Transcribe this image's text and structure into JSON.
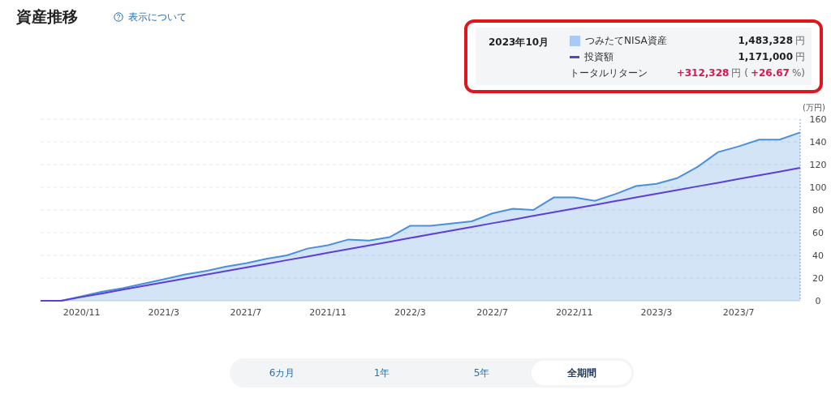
{
  "header": {
    "title": "資産推移",
    "help_link": "表示について"
  },
  "tooltip": {
    "month": "2023年10月",
    "rows": [
      {
        "kind": "swatch",
        "color": "#a9c9f7",
        "parts": [
          {
            "text": "1,483,328",
            "emphasis": false
          },
          {
            "text": "円",
            "emphasis": false
          }
        ]
      },
      {
        "kind": "line",
        "color": "#5b3fd8",
        "parts": [
          {
            "text": "1,171,000",
            "emphasis": false
          },
          {
            "text": "円",
            "emphasis": false
          }
        ]
      },
      {
        "kind": "plain",
        "label": "トータルリターン",
        "parts": [
          {
            "text": "+312,328",
            "emphasis": true
          },
          {
            "text": "円 (",
            "emphasis": false
          },
          {
            "text": "+26.67",
            "emphasis": true
          },
          {
            "text": "%)",
            "emphasis": false
          }
        ]
      }
    ]
  },
  "chart": {
    "unit": "(万円)",
    "chart_data": {
      "type": "area",
      "categories": [
        null,
        null,
        "2020/11",
        null,
        null,
        null,
        "2021/3",
        null,
        null,
        null,
        "2021/7",
        null,
        null,
        null,
        "2021/11",
        null,
        null,
        null,
        "2022/3",
        null,
        null,
        null,
        "2022/7",
        null,
        null,
        null,
        "2022/11",
        null,
        null,
        null,
        "2023/3",
        null,
        null,
        null,
        "2023/7",
        null,
        null,
        null
      ],
      "grid": true,
      "ylim": [
        0,
        160
      ],
      "yticks": [
        0,
        20,
        40,
        60,
        80,
        100,
        120,
        140,
        160
      ],
      "series": [
        {
          "name": "つみたてNISA資産",
          "type": "area",
          "color": "#4a8fdc",
          "values": [
            0,
            0,
            4,
            8,
            11,
            15,
            19,
            23,
            26,
            30,
            33,
            37,
            40,
            46,
            49,
            54,
            53,
            56,
            66,
            66,
            68,
            70,
            77,
            81,
            80,
            91,
            91,
            88,
            94,
            101,
            103,
            108,
            118,
            131,
            136,
            142,
            142,
            148.3
          ]
        },
        {
          "name": "投資額",
          "type": "line",
          "color": "#5b3fd8",
          "values": [
            0,
            0,
            3.3,
            6.5,
            9.8,
            13,
            16.3,
            19.5,
            22.8,
            26,
            29.3,
            32.5,
            35.8,
            39,
            42.3,
            45.5,
            48.8,
            52,
            55.3,
            58.5,
            61.8,
            65,
            68.3,
            71.5,
            74.8,
            78,
            81.3,
            84.5,
            87.8,
            91,
            94.3,
            97.5,
            100.8,
            104,
            107.3,
            110.5,
            113.8,
            117.1
          ]
        }
      ]
    }
  },
  "ranges": [
    {
      "label": "6カ月",
      "selected": false
    },
    {
      "label": "1年",
      "selected": false
    },
    {
      "label": "5年",
      "selected": false
    },
    {
      "label": "全期間",
      "selected": true
    }
  ]
}
